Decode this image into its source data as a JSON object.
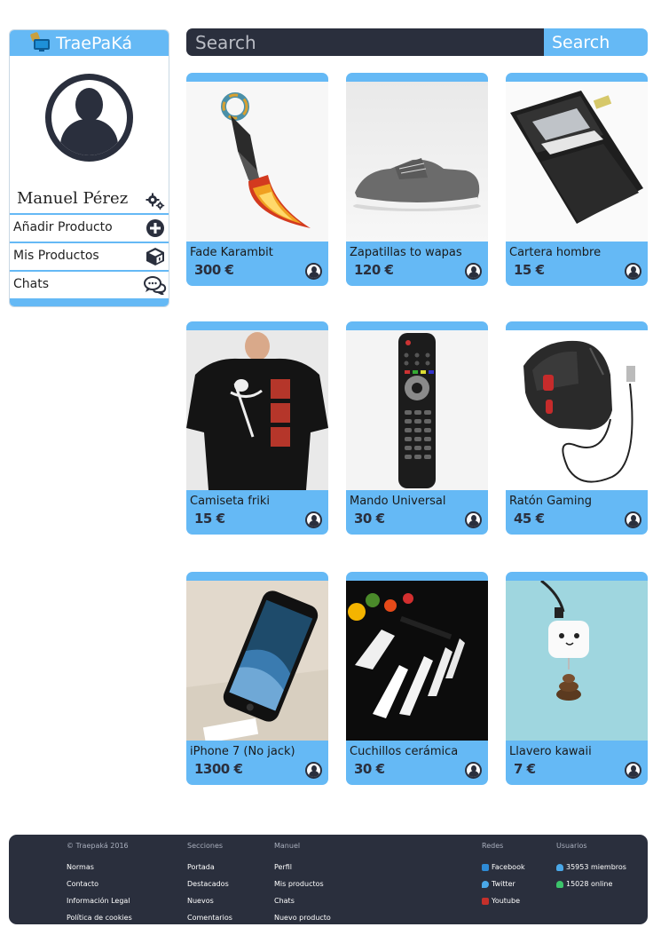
{
  "brand": {
    "name": "TraePaKá"
  },
  "sidebar": {
    "user_name": "Manuel Pérez",
    "items": [
      {
        "label": "Añadir Producto",
        "icon": "plus-circle-icon"
      },
      {
        "label": "Mis Productos",
        "icon": "box-icon"
      },
      {
        "label": "Chats",
        "icon": "chat-icon"
      }
    ]
  },
  "search": {
    "placeholder": "Search",
    "button_label": "Search"
  },
  "products": [
    {
      "title": "Fade Karambit",
      "price": "300 €"
    },
    {
      "title": "Zapatillas to wapas",
      "price": "120 €"
    },
    {
      "title": "Cartera hombre",
      "price": "15 €"
    },
    {
      "title": "Camiseta friki",
      "price": "15 €"
    },
    {
      "title": "Mando Universal",
      "price": "30 €"
    },
    {
      "title": "Ratón Gaming",
      "price": "45 €"
    },
    {
      "title": "iPhone 7 (No jack)",
      "price": "1300 €"
    },
    {
      "title": "Cuchillos cerámica",
      "price": "30 €"
    },
    {
      "title": "Llavero kawaii",
      "price": "7 €"
    }
  ],
  "footer": {
    "copyright": "© Traepaká 2016",
    "legal": [
      "Normas",
      "Contacto",
      "Información Legal",
      "Política de cookies"
    ],
    "secciones": {
      "title": "Secciones",
      "items": [
        "Portada",
        "Destacados",
        "Nuevos",
        "Comentarios"
      ]
    },
    "manuel": {
      "title": "Manuel",
      "items": [
        "Perfil",
        "Mis productos",
        "Chats",
        "Nuevo producto"
      ]
    },
    "redes": {
      "title": "Redes",
      "items": [
        "Facebook",
        "Twitter",
        "Youtube"
      ]
    },
    "usuarios": {
      "title": "Usuarios",
      "items": [
        "35953 miembros",
        "15028 online"
      ]
    }
  },
  "colors": {
    "accent": "#65b9f5",
    "dark": "#2a2f3d",
    "youtube": "#c4302b"
  }
}
